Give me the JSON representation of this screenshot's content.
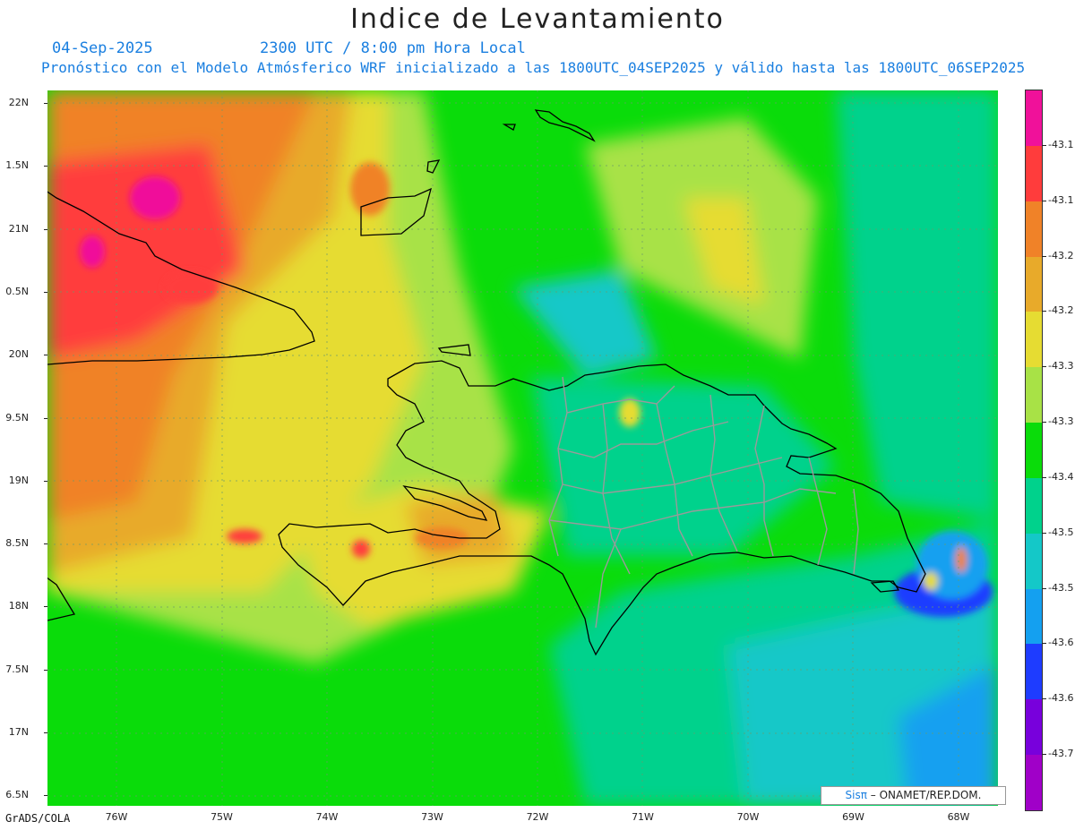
{
  "title": "Indice de Levantamiento",
  "header": {
    "date": "04-Sep-2025",
    "time": "2300 UTC / 8:00 pm Hora Local",
    "model_line": "Pronóstico con el Modelo Atmósferico WRF inicializado a las 1800UTC_04SEP2025 y válido hasta las  1800UTC_06SEP2025"
  },
  "axes": {
    "lat_labels": [
      "22N",
      "1.5N",
      "21N",
      "0.5N",
      "20N",
      "9.5N",
      "19N",
      "8.5N",
      "18N",
      "7.5N",
      "17N",
      "6.5N"
    ],
    "lon_labels": [
      "76W",
      "75W",
      "74W",
      "73W",
      "72W",
      "71W",
      "70W",
      "69W",
      "68W"
    ]
  },
  "colorbar": {
    "labels": [
      "-43.1",
      "-43.1",
      "-43.2",
      "-43.2",
      "-43.3",
      "-43.3",
      "-43.4",
      "-43.5",
      "-43.5",
      "-43.6",
      "-43.6",
      "-43.7"
    ],
    "colors": [
      "#f0119a",
      "#ff3c3c",
      "#f08228",
      "#e8aa2a",
      "#e6dc32",
      "#a8e246",
      "#0adc0a",
      "#00d28c",
      "#14c8c8",
      "#14a0f0",
      "#1e3cff",
      "#7800dc",
      "#a000c8"
    ]
  },
  "credit": {
    "sis": "Sisπ",
    "rest": "– ONAMET/REP.DOM."
  },
  "footer": "GrADS/COLA"
}
